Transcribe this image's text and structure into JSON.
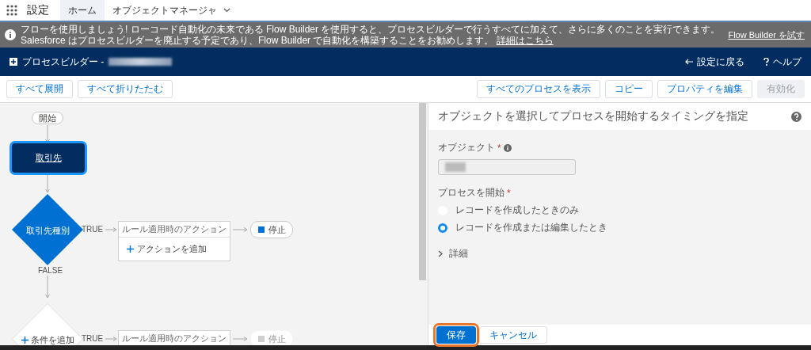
{
  "app_bar": {
    "app_name": "設定",
    "tabs": [
      {
        "label": "ホーム",
        "selected": true,
        "has_menu": false
      },
      {
        "label": "オブジェクトマネージャ",
        "selected": false,
        "has_menu": true
      }
    ]
  },
  "banner": {
    "message": "フローを使用しましょう! ローコード自動化の未来である Flow Builder を使用すると、プロセスビルダーで行うすべてに加えて、さらに多くのことを実行できます。Salesforce はプロセスビルダーを廃止する予定であり、Flow Builder で自動化を構築することをお勧めします。",
    "link": "詳細はこちら",
    "action": "Flow Builder を試す"
  },
  "header": {
    "title": "プロセスビルダー -",
    "back": "設定に戻る",
    "help": "ヘルプ"
  },
  "toolbar": {
    "left": [
      {
        "label": "すべて展開",
        "disabled": false
      },
      {
        "label": "すべて折りたたむ",
        "disabled": false
      }
    ],
    "right": [
      {
        "label": "すべてのプロセスを表示",
        "disabled": false
      },
      {
        "label": "コピー",
        "disabled": false
      },
      {
        "label": "プロパティを編集",
        "disabled": false
      },
      {
        "label": "有効化",
        "disabled": true
      }
    ]
  },
  "canvas": {
    "start": "開始",
    "object_node": {
      "label": "取引先",
      "selected": true
    },
    "false_label": "FALSE",
    "criteria": [
      {
        "kind": "criteria",
        "label": "取引先種別",
        "true_label": "TRUE",
        "action_header": "ルール適用時のアクション",
        "add_action": "アクションを追加",
        "stop": {
          "label": "停止",
          "disabled": false
        }
      },
      {
        "kind": "add",
        "label": "条件を追加",
        "true_label": "TRUE",
        "action_header": "ルール適用時のアクション",
        "stop": {
          "label": "停止",
          "disabled": true
        }
      }
    ]
  },
  "panel": {
    "title": "オブジェクトを選択してプロセスを開始するタイミングを指定",
    "object_label": "オブジェクト",
    "required_mark": "*",
    "start_label": "プロセスを開始",
    "options": [
      {
        "label": "レコードを作成したときのみ",
        "selected": false
      },
      {
        "label": "レコードを作成または編集したとき",
        "selected": true
      }
    ],
    "details": {
      "label": "詳細",
      "expanded": false
    },
    "buttons": [
      {
        "label": "保存",
        "kind": "primary",
        "highlighted": true
      },
      {
        "label": "キャンセル",
        "kind": "neutral",
        "highlighted": false
      }
    ]
  }
}
